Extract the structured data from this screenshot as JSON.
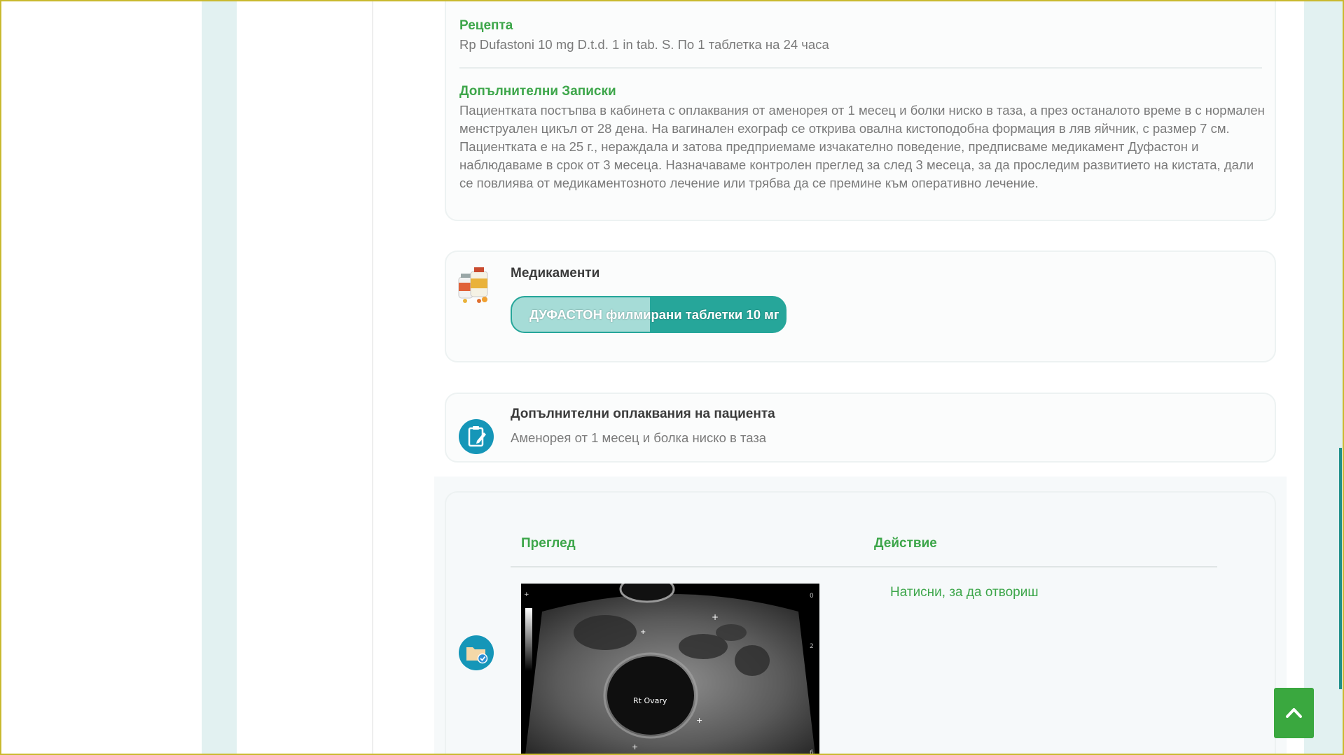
{
  "prescription": {
    "title": "Рецепта",
    "text": "Rp Dufastoni 10 mg D.t.d. 1 in tab. S. По 1 таблетка на 24 часа"
  },
  "notes": {
    "title": "Допълнителни Записки",
    "text": "Пациентката постъпва в кабинета с оплаквания от аменорея от 1 месец и болки ниско в таза, а през останалото време в с нормален менструален цикъл от 28 дена. На вагинален ехограф се открива овална кистоподобна формация в ляв яйчник, с размер 7 см. Пациентката е на 25 г., нераждала и затова предприемаме изчакателно поведение, предписваме медикамент Дуфастон и наблюдаваме в срок от 3 месеца. Назначаваме контролен преглед за след 3 месеца, за да проследим развитието на кистата, дали се повлиява от медикаментозното лечение или трябва да се премине към оперативно лечение."
  },
  "medications": {
    "title": "Медикаменти",
    "items": [
      {
        "label": "ДУФАСТОН филмирани таблетки 10 мг",
        "progress": 0.5
      }
    ]
  },
  "complaints": {
    "title": "Допълнителни оплаквания на пациента",
    "text": "Аменорея от 1 месец и болка ниско в таза"
  },
  "exam": {
    "columns": [
      "Преглед",
      "Действие"
    ],
    "image_label": "Rt Ovary",
    "action_link": "Натисни, за да отвориш"
  },
  "icons": {
    "meds": "medicine-bottles-icon",
    "complaints": "clipboard-pen-icon",
    "exam": "folder-check-icon",
    "back_to_top": "chevron-up-icon"
  },
  "colors": {
    "accent_green": "#3da64a",
    "teal": "#26a69a",
    "teal_light": "#a6dcd7",
    "side_strip": "#e2f1f1",
    "icon_circle": "#1596b8",
    "back_to_top": "#3aa83f"
  }
}
